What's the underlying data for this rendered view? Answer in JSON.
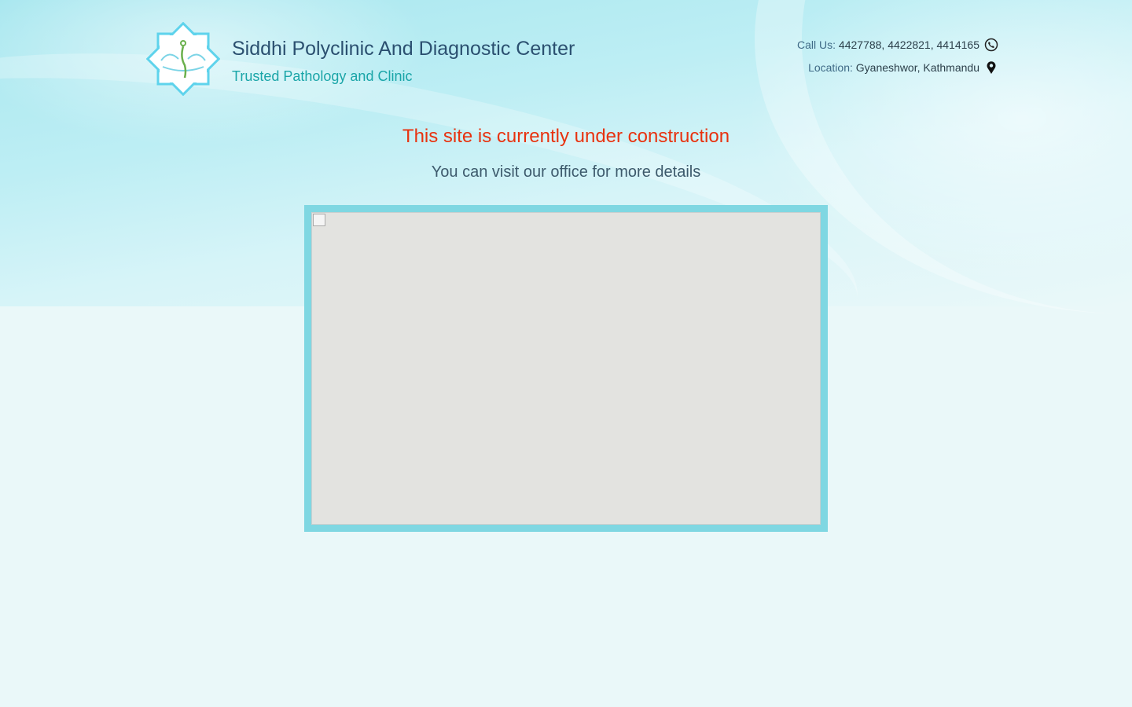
{
  "header": {
    "title": "Siddhi Polyclinic And Diagnostic Center",
    "tagline": "Trusted Pathology and Clinic"
  },
  "contact": {
    "call_label": "Call Us:",
    "phones": "4427788, 4422821, 4414165",
    "location_label": "Location:",
    "location": "Gyaneshwor, Kathmandu"
  },
  "main": {
    "notice": "This site is currently under construction",
    "details": "You can visit our office for more details"
  },
  "colors": {
    "notice": "#e8320f",
    "tagline": "#1aa5a8",
    "frame": "#7fd7e2"
  }
}
